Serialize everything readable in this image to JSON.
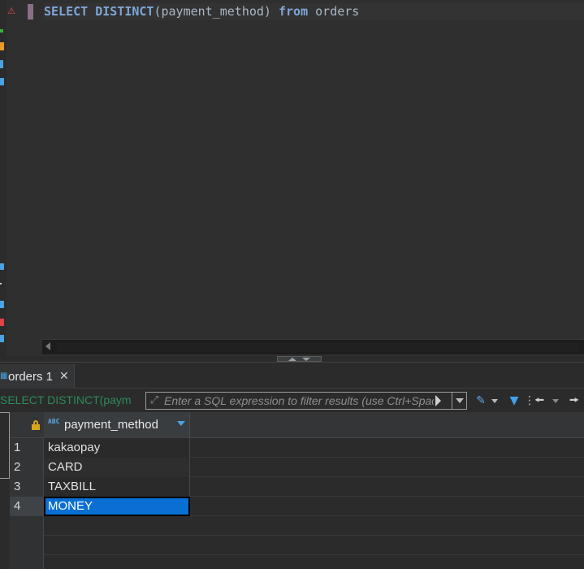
{
  "editor": {
    "sql": {
      "kw1": "SELECT DISTINCT",
      "args": "(payment_method)",
      "kw2": "from",
      "table": "orders"
    },
    "warning_icon": "warning-triangle-icon"
  },
  "results": {
    "tab_label": "orders 1",
    "filter": {
      "current_query": "SELECT DISTINCT(paym",
      "placeholder": "Enter a SQL expression to filter results (use Ctrl+Space)"
    },
    "columns": [
      {
        "name": "payment_method",
        "type_icon": "ABC"
      }
    ],
    "rows": [
      {
        "num": "1",
        "value": "kakaopay"
      },
      {
        "num": "2",
        "value": "CARD"
      },
      {
        "num": "3",
        "value": "TAXBILL"
      },
      {
        "num": "4",
        "value": "MONEY"
      }
    ],
    "selected_row": 4
  },
  "colors": {
    "keyword": "#7ea6d6",
    "selection": "#0a6fd3",
    "background": "#2b2b2b"
  }
}
